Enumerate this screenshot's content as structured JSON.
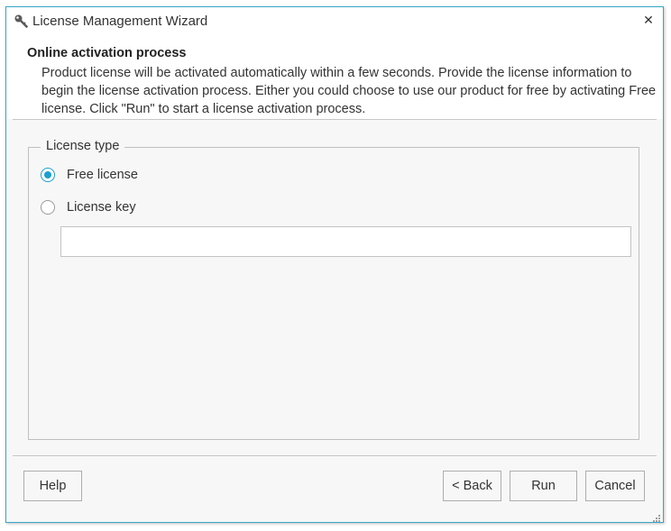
{
  "window": {
    "title": "License Management Wizard",
    "icon": "key-icon",
    "close_glyph": "✕"
  },
  "header": {
    "title": "Online activation process",
    "description": "Product license will be activated automatically within a few seconds. Provide the license information to begin the license activation process. Either you could choose to use our product for free by activating Free license. Click \"Run\" to start a license activation process."
  },
  "license_type": {
    "legend": "License type",
    "options": [
      {
        "label": "Free license",
        "checked": true
      },
      {
        "label": "License key",
        "checked": false
      }
    ],
    "key_value": "",
    "key_placeholder": ""
  },
  "buttons": {
    "help": "Help",
    "back": "< Back",
    "run": "Run",
    "cancel": "Cancel"
  },
  "colors": {
    "accent": "#1b9fd0",
    "window_border": "#3aa6c6",
    "panel_bg": "#f7f7f7"
  }
}
